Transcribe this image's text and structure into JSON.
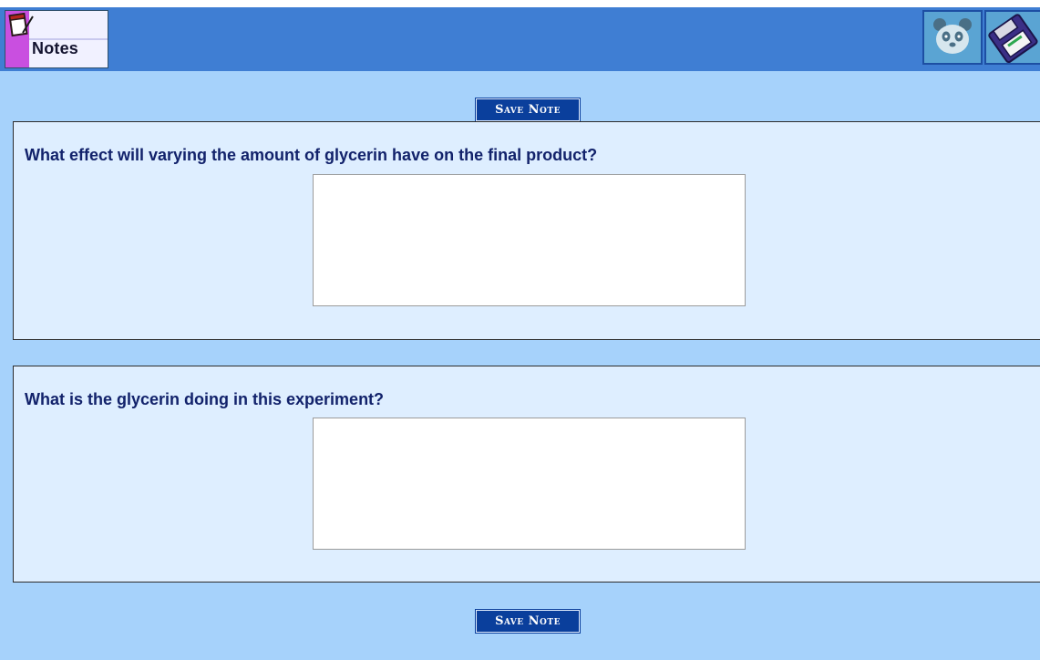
{
  "header": {
    "logo_label": "Notes",
    "icons": [
      "notepad-icon",
      "panda-icon",
      "save-disk-icon"
    ]
  },
  "buttons": {
    "save_note_top": "Save Note",
    "save_note_bottom": "Save Note"
  },
  "questions": [
    {
      "prompt": "What effect will varying the amount of glycerin have on the final product?",
      "answer": ""
    },
    {
      "prompt": "What is the glycerin doing in this experiment?",
      "answer": ""
    }
  ],
  "colors": {
    "header_bar": "#3f7ed3",
    "page_background": "#a6d2fb",
    "panel_background": "#deeeff",
    "button_background": "#0a3f9c",
    "question_text": "#12226b"
  }
}
